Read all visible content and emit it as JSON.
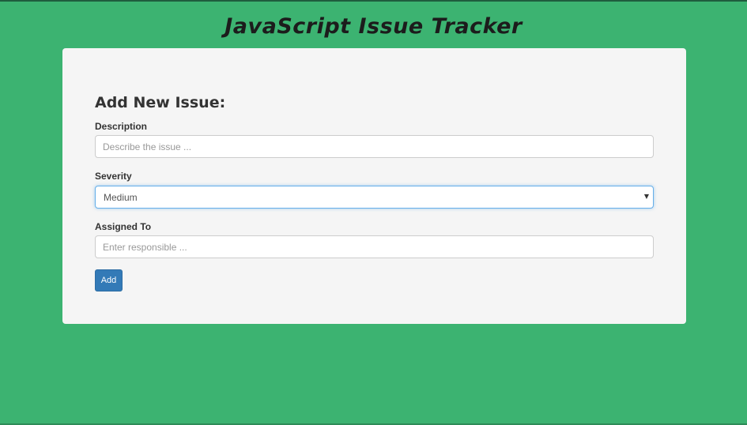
{
  "app": {
    "title": "JavaScript Issue Tracker"
  },
  "form": {
    "heading": "Add New Issue:",
    "description": {
      "label": "Description",
      "placeholder": "Describe the issue ...",
      "value": ""
    },
    "severity": {
      "label": "Severity",
      "selected": "Medium",
      "arrow_icon": "caret-down-icon"
    },
    "assigned_to": {
      "label": "Assigned To",
      "placeholder": "Enter responsible ...",
      "value": ""
    },
    "submit_label": "Add"
  },
  "colors": {
    "background": "#3cb371",
    "card": "#f5f5f5",
    "button": "#337ab7",
    "focus_border": "#66afe9"
  }
}
